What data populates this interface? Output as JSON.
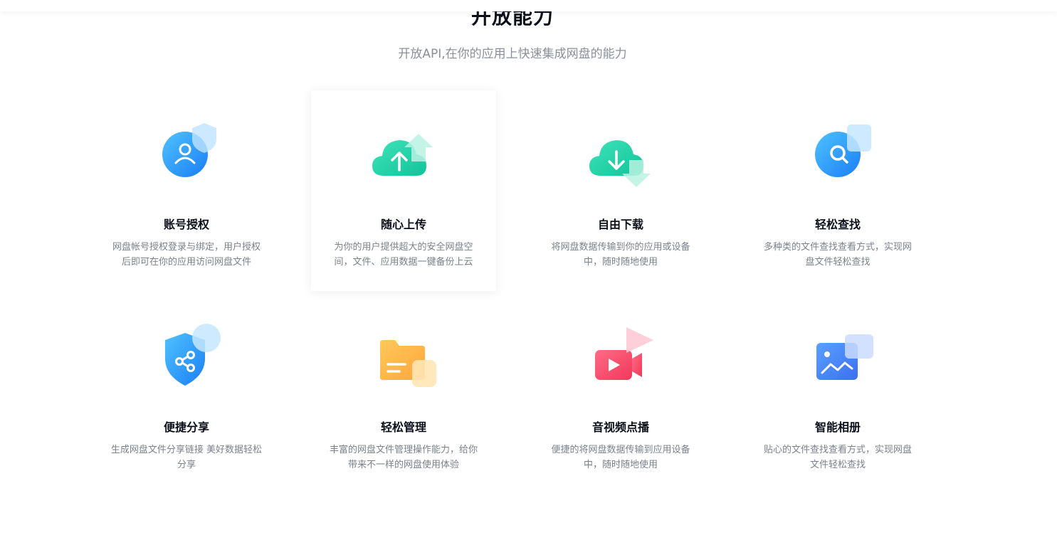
{
  "section": {
    "title": "开放能力",
    "subtitle": "开放API,在你的应用上快速集成网盘的能力"
  },
  "features": [
    {
      "title": "账号授权",
      "desc": "网盘帐号授权登录与绑定，用户授权后即可在你的应用访问网盘文件",
      "icon": "user-shield-icon",
      "active": false
    },
    {
      "title": "随心上传",
      "desc": "为你的用户提供超大的安全网盘空间，文件、应用数据一键备份上云",
      "icon": "cloud-upload-icon",
      "active": true
    },
    {
      "title": "自由下载",
      "desc": "将网盘数据传输到你的应用或设备中，随时随地使用",
      "icon": "cloud-download-icon",
      "active": false
    },
    {
      "title": "轻松查找",
      "desc": "多种类的文件查找查看方式，实现网盘文件轻松查找",
      "icon": "search-icon",
      "active": false
    },
    {
      "title": "便捷分享",
      "desc": "生成网盘文件分享链接 美好数据轻松分享",
      "icon": "share-shield-icon",
      "active": false
    },
    {
      "title": "轻松管理",
      "desc": "丰富的网盘文件管理操作能力，给你带来不一样的网盘使用体验",
      "icon": "folder-icon",
      "active": false
    },
    {
      "title": "音视频点播",
      "desc": "便捷的将网盘数据传输到应用设备中，随时随地使用",
      "icon": "video-play-icon",
      "active": false
    },
    {
      "title": "智能相册",
      "desc": "贴心的文件查找查看方式，实现网盘文件轻松查找",
      "icon": "photo-album-icon",
      "active": false
    }
  ],
  "colors": {
    "blue": "#1e90ff",
    "green": "#1dd3a6",
    "orange": "#ffb547",
    "red": "#ff4f6e"
  }
}
